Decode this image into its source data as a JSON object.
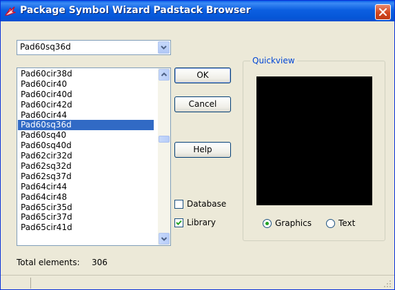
{
  "window": {
    "title": "Package Symbol Wizard Padstack Browser",
    "icons": {
      "app": "wizard-app-icon",
      "close": "close-icon"
    }
  },
  "combo": {
    "selected_value": "Pad60sq36d",
    "icon": "chevron-down-icon"
  },
  "list": {
    "items": [
      "Pad60cir38d",
      "Pad60cir40",
      "Pad60cir40d",
      "Pad60cir42d",
      "Pad60cir44",
      "Pad60sq36d",
      "Pad60sq40",
      "Pad60sq40d",
      "Pad62cir32d",
      "Pad62sq32d",
      "Pad62sq37d",
      "Pad64cir44",
      "Pad64cir48",
      "Pad65cir35d",
      "Pad65cir37d",
      "Pad65cir41d"
    ],
    "selected_index": 5
  },
  "buttons": {
    "ok": "OK",
    "cancel": "Cancel",
    "help": "Help"
  },
  "sources": {
    "database": {
      "label": "Database",
      "checked": false
    },
    "library": {
      "label": "Library",
      "checked": true
    }
  },
  "quickview": {
    "label": "Quickview",
    "preview_color": "#000000",
    "mode_graphics": {
      "label": "Graphics",
      "selected": true
    },
    "mode_text": {
      "label": "Text",
      "selected": false
    }
  },
  "footer": {
    "total_label": "Total elements:",
    "total_value": "306"
  },
  "colors": {
    "selection": "#316ac5",
    "titlebar": "#0a5fe8",
    "groupbox_label": "#0046d5",
    "dialog_bg": "#ece9d8"
  }
}
